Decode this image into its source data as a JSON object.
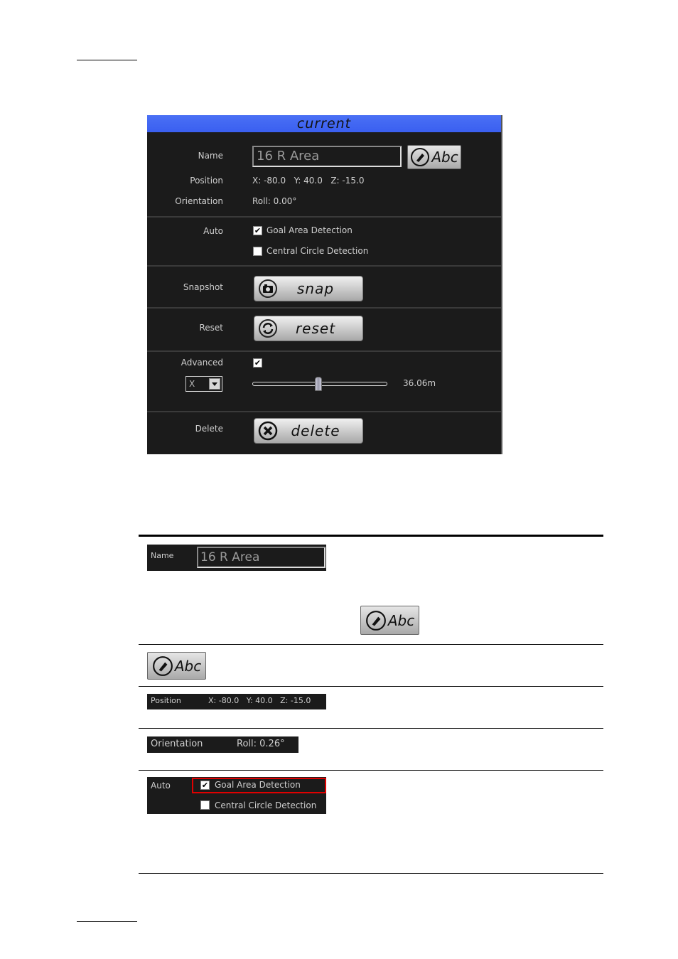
{
  "panel": {
    "title": "current",
    "name_label": "Name",
    "name_value": "16 R Area",
    "edit_button_label": "Abc",
    "position_label": "Position",
    "position_value": "X: -80.0   Y: 40.0   Z: -15.0",
    "orientation_label": "Orientation",
    "orientation_value": "Roll: 0.00°",
    "auto_label": "Auto",
    "auto_options": [
      {
        "label": "Goal Area Detection",
        "checked": true
      },
      {
        "label": "Central Circle Detection",
        "checked": false
      }
    ],
    "snapshot_label": "Snapshot",
    "snap_button": "snap",
    "reset_label": "Reset",
    "reset_button": "reset",
    "advanced_label": "Advanced",
    "advanced_checked": true,
    "axis_select": "X",
    "slider_fraction": 0.49,
    "slider_value": "36.06m",
    "delete_label": "Delete",
    "delete_button": "delete"
  },
  "table": {
    "rows": [
      {
        "name_label": "Name",
        "name_value": "16 R Area",
        "abc_label": "Abc"
      },
      {
        "abc_label": "Abc"
      },
      {
        "position_label": "Position",
        "position_value": "X: -80.0   Y: 40.0   Z: -15.0"
      },
      {
        "orientation_label": "Orientation",
        "orientation_value": "Roll: 0.26°"
      },
      {
        "auto_label": "Auto",
        "option1": "Goal Area Detection",
        "option2": "Central Circle Detection"
      }
    ]
  },
  "icons": {
    "edit": "pencil-circle-icon",
    "snap": "camera-icon",
    "reset": "refresh-icon",
    "delete": "x-circle-icon"
  },
  "colors": {
    "header_blue": "#3a5ff0",
    "panel_bg": "#1b1b1b",
    "highlight_red": "#e00000"
  }
}
